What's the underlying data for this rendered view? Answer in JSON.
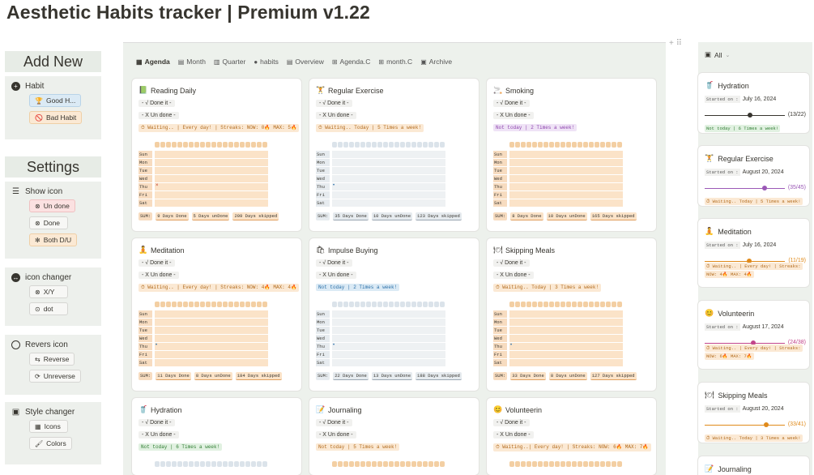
{
  "page_title": "Aesthetic Habits tracker | Premium v1.22",
  "left": {
    "add_new": "Add New",
    "habit_label": "Habit",
    "good_habit": "Good H...",
    "bad_habit": "Bad Habit",
    "settings": "Settings",
    "show_icon": "Show icon",
    "un_done": "Un done",
    "done": "Done",
    "both": "Both D/U",
    "icon_changer": "icon changer",
    "xy": "X/Y",
    "dot": "dot",
    "revers_icon": "Revers icon",
    "reverse": "Reverse",
    "unreverse": "Unreverse",
    "style_changer": "Style changer",
    "icons": "Icons",
    "colors": "Colors"
  },
  "tabs": [
    {
      "label": "Agenda",
      "icon": "▦",
      "active": true
    },
    {
      "label": "Month",
      "icon": "▤",
      "active": false
    },
    {
      "label": "Quarter",
      "icon": "▥",
      "active": false
    },
    {
      "label": "habits",
      "icon": "●",
      "active": false
    },
    {
      "label": "Overview",
      "icon": "▤",
      "active": false
    },
    {
      "label": "Agenda.C",
      "icon": "⊞",
      "active": false
    },
    {
      "label": "month.C",
      "icon": "⊞",
      "active": false
    },
    {
      "label": "Archive",
      "icon": "▣",
      "active": false
    }
  ],
  "days": [
    "Sun",
    "Mon",
    "Tue",
    "Wed",
    "Thu",
    "Fri",
    "Sat"
  ],
  "cards": [
    {
      "title": "Reading Daily",
      "icon": "📗",
      "done": "- √ Done it -",
      "undone": "- X Un done -",
      "status": "⏱ Waiting.. | Every day! | Streaks: NOW: 0🔥 MAX: 5🔥",
      "status_kind": "orange",
      "sums": [
        "9 Days Done",
        "5 Days unDone",
        "209 Days skipped"
      ],
      "theme": "orange",
      "marker": "x"
    },
    {
      "title": "Regular Exercise",
      "icon": "🏋",
      "done": "- √ Done it -",
      "undone": "- X Un done -",
      "status": "⏱ Waiting.. Today | 5 Times a week!",
      "status_kind": "orange",
      "sums": [
        "35 Days Done",
        "10 Days unDone",
        "123 Days skipped"
      ],
      "theme": "grey",
      "marker": "dot"
    },
    {
      "title": "Smoking",
      "icon": "🚬",
      "done": "- √ Done it -",
      "undone": "- X Un done -",
      "status": "Not today | 2 Times a week!",
      "status_kind": "purple",
      "sums": [
        "8 Days Done",
        "10 Days unDone",
        "165 Days skipped"
      ],
      "theme": "orange",
      "marker": "none"
    },
    {
      "title": "Meditation",
      "icon": "🧘",
      "done": "- √ Done it -",
      "undone": "- X Un done -",
      "status": "⏱ Waiting.. | Every day! | Streaks: NOW: 4🔥 MAX: 4🔥",
      "status_kind": "orange",
      "sums": [
        "11 Days Done",
        "8 Days unDone",
        "184 Days skipped"
      ],
      "theme": "orange",
      "marker": "dot"
    },
    {
      "title": "Impulse Buying",
      "icon": "🛍",
      "done": "- √ Done it -",
      "undone": "- X Un done -",
      "status": "Not today | 2 Times a week!",
      "status_kind": "blue",
      "sums": [
        "22 Days Done",
        "13 Days unDone",
        "188 Days skipped"
      ],
      "theme": "grey",
      "marker": "dot"
    },
    {
      "title": "Skipping Meals",
      "icon": "🍽",
      "done": "- √ Done it -",
      "undone": "- X Un done -",
      "status": "⏱ Waiting.. Today | 3 Times a week!",
      "status_kind": "orange",
      "sums": [
        "33 Days Done",
        "8 Days unDone",
        "127 Days skipped"
      ],
      "theme": "orange",
      "marker": "dot"
    },
    {
      "title": "Hydration",
      "icon": "🥤",
      "done": "- √ Done it -",
      "undone": "- X Un done -",
      "status": "Not today | 6 Times a week!",
      "status_kind": "green",
      "sums": [],
      "theme": "grey",
      "marker": "none"
    },
    {
      "title": "Journaling",
      "icon": "📝",
      "done": "- √ Done it -",
      "undone": "- X Un done -",
      "status": "Not today | 5 Times a week!",
      "status_kind": "orange",
      "sums": [],
      "theme": "orange",
      "marker": "none"
    },
    {
      "title": "Volunteerin",
      "icon": "😊",
      "done": "- √ Done it -",
      "undone": "- X Un done -",
      "status": "⏱ Waiting..| Every day! | Streaks: NOW: 6🔥 MAX: 7🔥",
      "status_kind": "orange",
      "sums": [],
      "theme": "orange",
      "marker": "none"
    }
  ],
  "right": {
    "filter": "All",
    "started_label": "Started on :",
    "cards": [
      {
        "title": "Hydration",
        "icon": "🥤",
        "date": "July 16, 2024",
        "count": "(13/22)",
        "progress": 0.59,
        "color": "#37352f",
        "status": [
          "Not today | 6 Times a week!"
        ],
        "status_kind": "green"
      },
      {
        "title": "Regular Exercise",
        "icon": "🏋",
        "date": "August 20, 2024",
        "count": "(35/45)",
        "progress": 0.78,
        "color": "#9b59b6",
        "status": [
          "⏱ Waiting.. Today | 5 Times a week!"
        ],
        "status_kind": "orange"
      },
      {
        "title": "Meditation",
        "icon": "🧘",
        "date": "July 16, 2024",
        "count": "(11/19)",
        "progress": 0.58,
        "color": "#e08a1a",
        "status": [
          "⏱ Waiting.. | Every day! | Streaks:",
          "NOW: 4🔥 MAX: 4🔥"
        ],
        "status_kind": "orange"
      },
      {
        "title": "Volunteerin",
        "icon": "😊",
        "date": "August 17, 2024",
        "count": "(24/38)",
        "progress": 0.63,
        "color": "#c2458a",
        "status": [
          "⏱ Waiting.. | Every day! | Streaks:",
          "NOW: 6🔥 MAX: 7🔥"
        ],
        "status_kind": "orange"
      },
      {
        "title": "Skipping Meals",
        "icon": "🍽",
        "date": "August 20, 2024",
        "count": "(33/41)",
        "progress": 0.8,
        "color": "#e08a1a",
        "status": [
          "⏱ Waiting.. Today | 3 Times a week!"
        ],
        "status_kind": "orange"
      },
      {
        "title": "Journaling",
        "icon": "📝",
        "date": "",
        "count": "",
        "progress": 0,
        "color": "#e08a1a",
        "status": [],
        "status_kind": "orange"
      }
    ]
  }
}
